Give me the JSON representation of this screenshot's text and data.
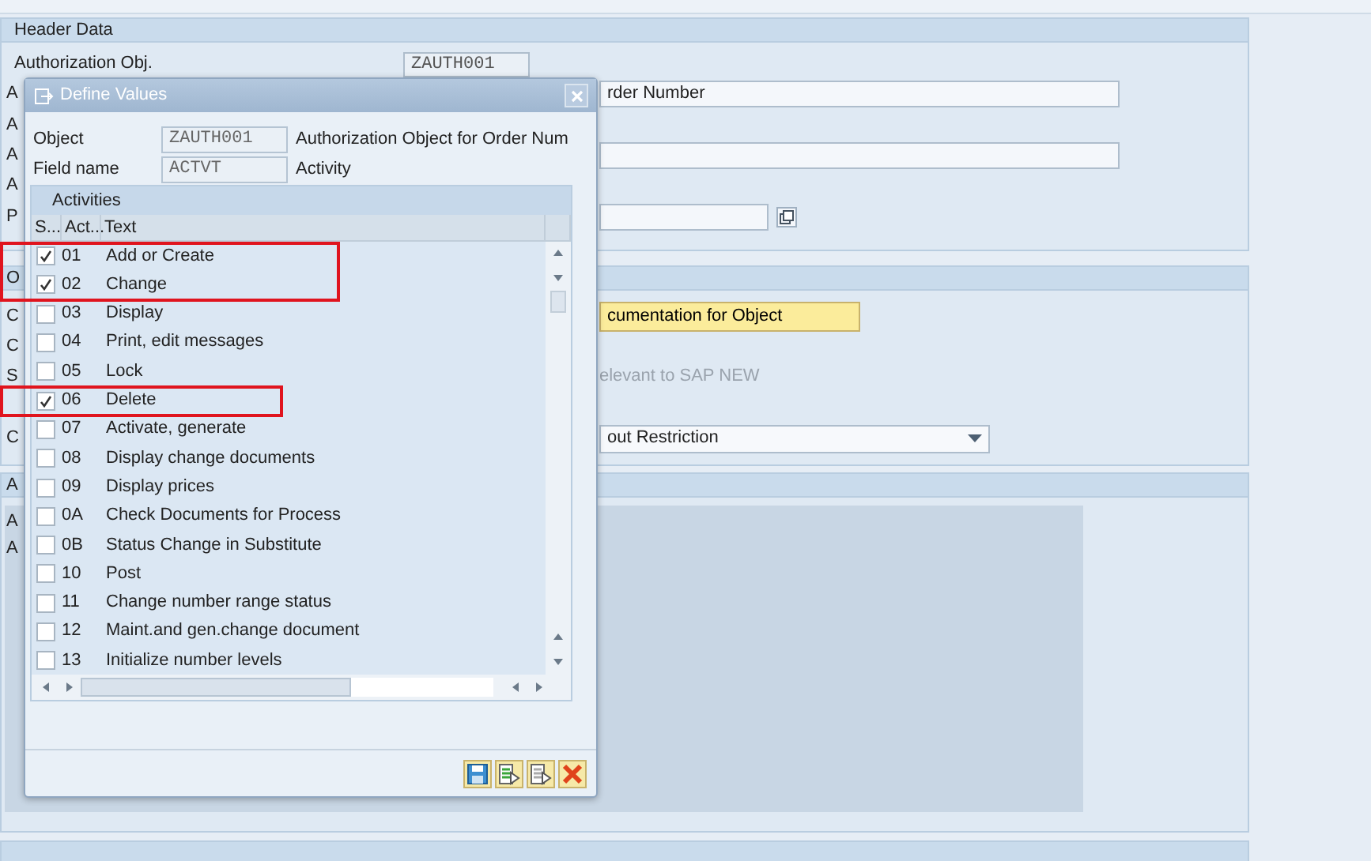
{
  "header_data": {
    "title": "Header Data",
    "rows": [
      {
        "kind": "field",
        "label": "Authorization Obj.",
        "value": "ZAUTH001"
      },
      {
        "kind": "wide_field",
        "label": "A",
        "value": "rder Number"
      },
      {
        "kind": "blank",
        "label": "A"
      },
      {
        "kind": "wide_field",
        "label": "A"
      },
      {
        "kind": "blank",
        "label": "A"
      },
      {
        "kind": "field_button",
        "label": "P"
      }
    ]
  },
  "section_2": {
    "title": "O",
    "rows": [
      {
        "kind": "button",
        "label": "C",
        "value": "cumentation for Object"
      },
      {
        "kind": "blank",
        "label": "C"
      },
      {
        "kind": "note",
        "label": "S",
        "value": "elevant to SAP NEW"
      },
      {
        "kind": "blank"
      },
      {
        "kind": "dropdown",
        "label": "C",
        "value": "out Restriction"
      }
    ]
  },
  "section_3": {
    "title": "A",
    "labels": [
      "A",
      "A"
    ]
  },
  "dialog": {
    "title": "Define Values",
    "object_label": "Object",
    "object_value": "ZAUTH001",
    "object_desc": "Authorization Object for Order Num",
    "field_label": "Field name",
    "field_value": "ACTVT",
    "field_desc": "Activity",
    "table": {
      "title": "Activities",
      "columns": [
        "S...",
        "Act...",
        "Text"
      ],
      "rows": [
        {
          "checked": true,
          "boxed": true,
          "code": "01",
          "text": "Add or Create"
        },
        {
          "checked": true,
          "boxed": true,
          "code": "02",
          "text": "Change"
        },
        {
          "checked": false,
          "boxed": false,
          "code": "03",
          "text": "Display"
        },
        {
          "checked": false,
          "boxed": false,
          "code": "04",
          "text": "Print, edit messages"
        },
        {
          "checked": false,
          "boxed": false,
          "code": "05",
          "text": "Lock"
        },
        {
          "checked": true,
          "boxed": true,
          "code": "06",
          "text": "Delete"
        },
        {
          "checked": false,
          "boxed": false,
          "code": "07",
          "text": "Activate, generate"
        },
        {
          "checked": false,
          "boxed": false,
          "code": "08",
          "text": "Display change documents"
        },
        {
          "checked": false,
          "boxed": false,
          "code": "09",
          "text": "Display prices"
        },
        {
          "checked": false,
          "boxed": false,
          "code": "0A",
          "text": "Check Documents for Process"
        },
        {
          "checked": false,
          "boxed": false,
          "code": "0B",
          "text": "Status Change in Substitute"
        },
        {
          "checked": false,
          "boxed": false,
          "code": "10",
          "text": "Post"
        },
        {
          "checked": false,
          "boxed": false,
          "code": "11",
          "text": "Change number range status"
        },
        {
          "checked": false,
          "boxed": false,
          "code": "12",
          "text": "Maint.and gen.change document"
        },
        {
          "checked": false,
          "boxed": false,
          "code": "13",
          "text": "Initialize number levels"
        }
      ]
    }
  }
}
